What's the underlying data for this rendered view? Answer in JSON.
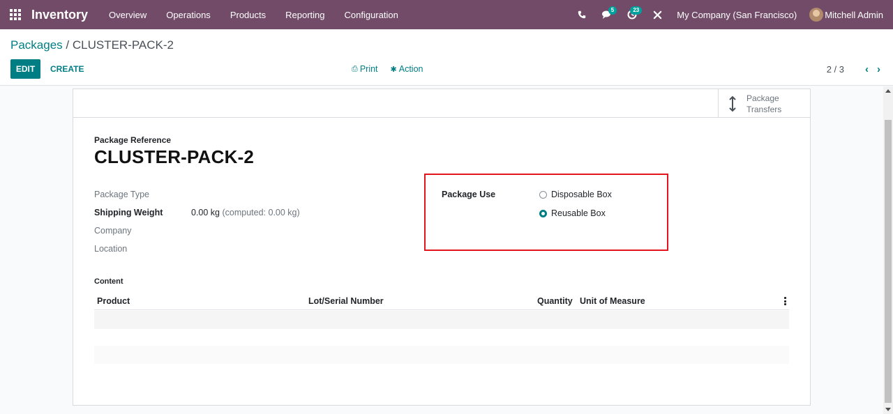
{
  "navbar": {
    "brand": "Inventory",
    "menu": [
      "Overview",
      "Operations",
      "Products",
      "Reporting",
      "Configuration"
    ],
    "messages_badge": "5",
    "activities_badge": "23",
    "company": "My Company (San Francisco)",
    "user": "Mitchell Admin",
    "color": "#714b67"
  },
  "breadcrumb": {
    "parent": "Packages",
    "separator": " / ",
    "current": "CLUSTER-PACK-2"
  },
  "buttons": {
    "edit": "EDIT",
    "create": "CREATE",
    "print": "Print",
    "action": "Action"
  },
  "pager": {
    "value": "2 / 3"
  },
  "stat_button": {
    "line1": "Package",
    "line2": "Transfers"
  },
  "form": {
    "ref_label": "Package Reference",
    "name": "CLUSTER-PACK-2",
    "package_type_label": "Package Type",
    "shipping_weight_label": "Shipping Weight",
    "shipping_weight_value": "0.00 kg",
    "shipping_weight_computed": "(computed: 0.00 kg)",
    "company_label": "Company",
    "location_label": "Location",
    "package_use_label": "Package Use",
    "package_use_options": [
      "Disposable Box",
      "Reusable Box"
    ],
    "package_use_selected": "Reusable Box"
  },
  "content": {
    "label": "Content",
    "columns": [
      "Product",
      "Lot/Serial Number",
      "Quantity",
      "Unit of Measure"
    ]
  },
  "colors": {
    "primary": "#017e84",
    "highlight": "#e3141c"
  }
}
